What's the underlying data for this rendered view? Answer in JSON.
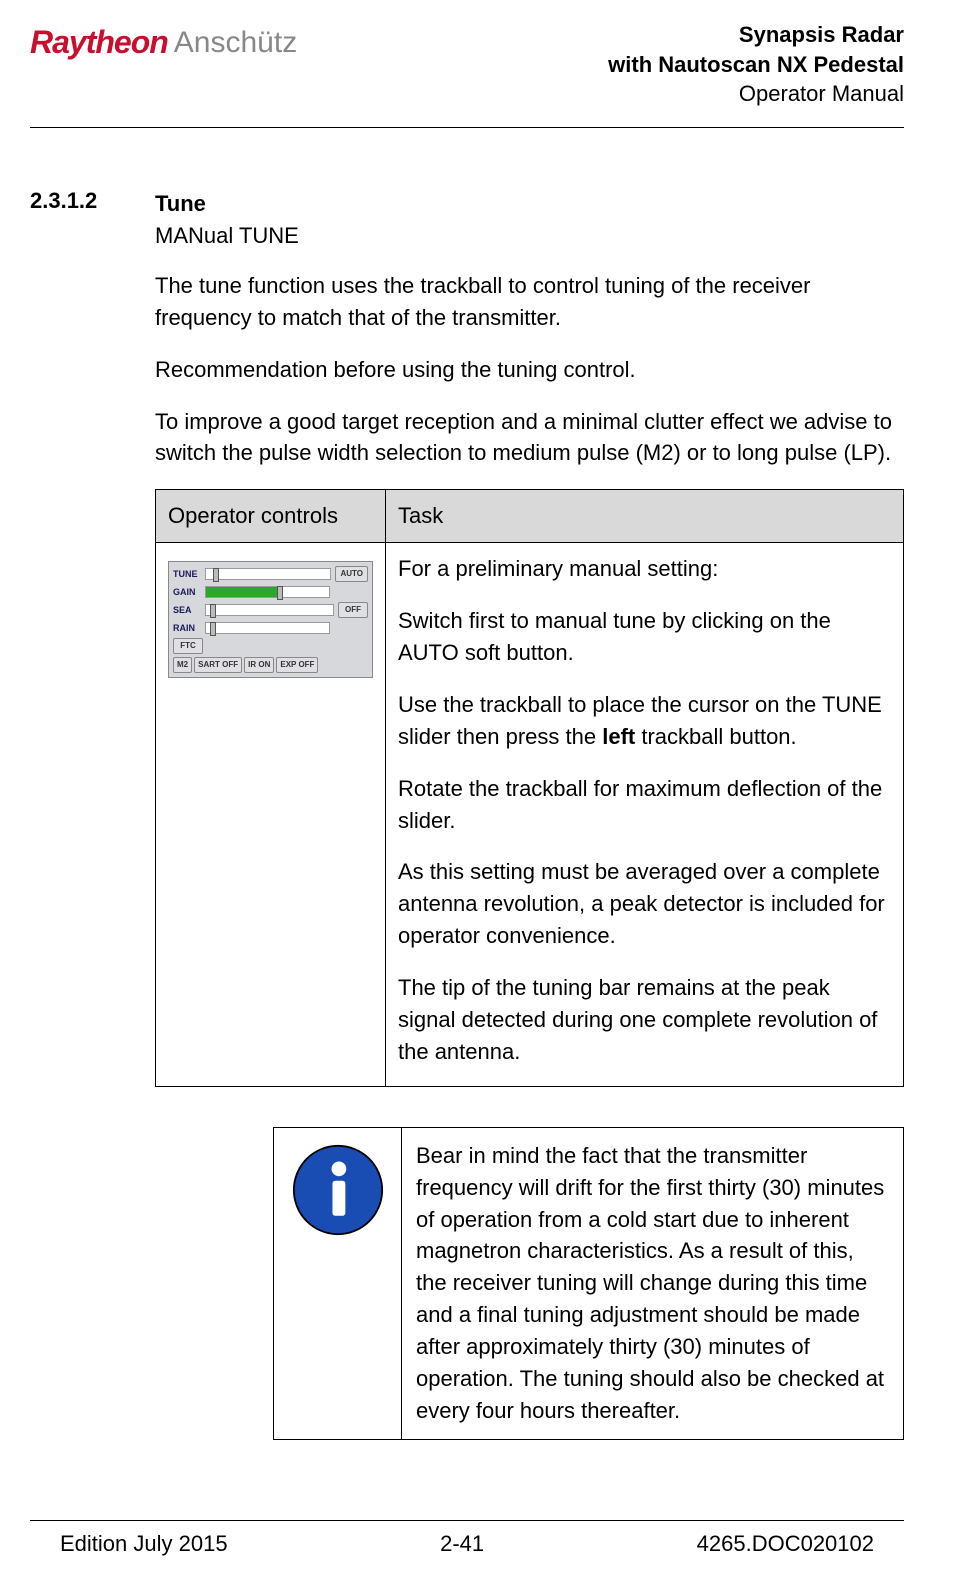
{
  "header": {
    "logo_a": "Raytheon",
    "logo_b": "Anschütz",
    "title1": "Synapsis Radar",
    "title2": "with Nautoscan NX Pedestal",
    "title3": "Operator Manual"
  },
  "section": {
    "number": "2.3.1.2",
    "title": "Tune",
    "subtitle": "MANual TUNE",
    "para1": "The tune function uses the trackball to control tuning of the receiver frequency to match that of the transmitter.",
    "para2": "Recommendation before using the tuning control.",
    "para3": "To improve a good target reception and a minimal clutter effect we advise to switch the pulse width selection to medium pulse (M2) or to long pulse (LP)."
  },
  "table": {
    "headers": {
      "col1": "Operator controls",
      "col2": "Task"
    },
    "task": {
      "p1": "For a preliminary manual setting:",
      "p2": "Switch first to manual tune by clicking on the AUTO soft button.",
      "p3a": "Use the trackball to place the cursor on the TUNE slider then press the ",
      "p3b": "left",
      "p3c": " trackball button.",
      "p4": "Rotate the trackball for maximum deflection of the slider.",
      "p5": "As this setting must be averaged over a complete antenna revolution, a peak detector is included for operator convenience.",
      "p6": "The tip of the tuning bar remains at the peak signal detected during one complete revolution of the antenna."
    }
  },
  "panel": {
    "tune": "TUNE",
    "gain": "GAIN",
    "sea": "SEA",
    "rain": "RAIN",
    "ftc": "FTC",
    "auto": "AUTO",
    "off": "OFF",
    "m2": "M2",
    "sart": "SART OFF",
    "ir": "IR ON",
    "exp": "EXP OFF"
  },
  "note": {
    "text": "Bear in mind the fact that the transmitter frequency will drift for the first thirty (30) minutes of operation from a cold start due to inherent magnetron characteristics. As a result of this, the receiver tuning will change during this time and a final tuning adjustment should be made after approximately thirty (30) minutes of operation. The tuning should also be checked at every four hours thereafter."
  },
  "footer": {
    "left": "Edition July 2015",
    "center": "2-41",
    "right": "4265.DOC020102"
  }
}
